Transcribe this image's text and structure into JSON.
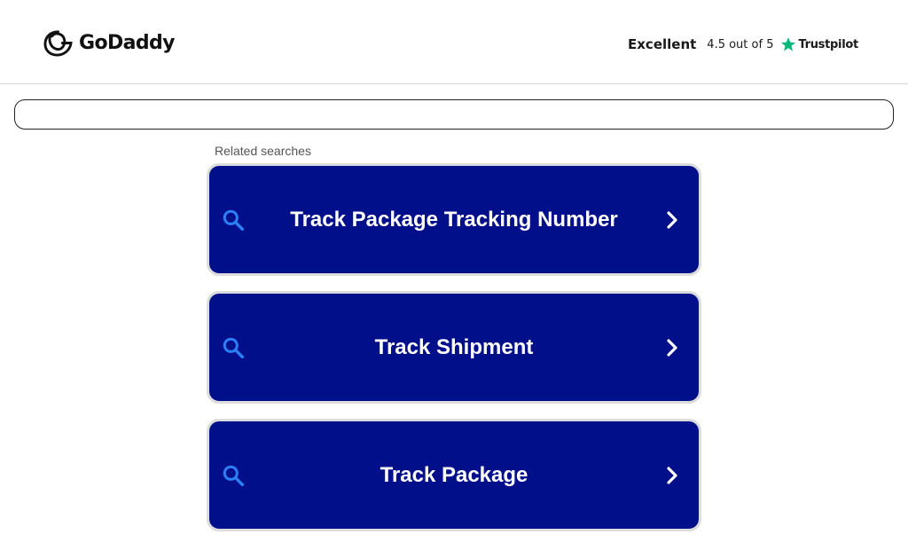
{
  "header": {
    "logo_text": "GoDaddy",
    "logo_icon": "godaddy-logo-icon",
    "rating": {
      "label": "Excellent",
      "score_text": "4.5 out of 5",
      "star_icon": "star-icon",
      "brand": "Trustpilot",
      "star_color": "#00b67a"
    }
  },
  "search": {
    "value": "",
    "placeholder": ""
  },
  "related": {
    "heading": "Related searches",
    "items": [
      {
        "label": "Track Package Tracking Number"
      },
      {
        "label": "Track Shipment"
      },
      {
        "label": "Track Package"
      }
    ],
    "search_icon": "search-icon",
    "arrow_icon": "chevron-right-icon",
    "colors": {
      "card_background": "#020f8b",
      "card_border": "#dcdcdc",
      "icon_color": "#2d7ff5",
      "label_color": "#ffffff"
    }
  }
}
